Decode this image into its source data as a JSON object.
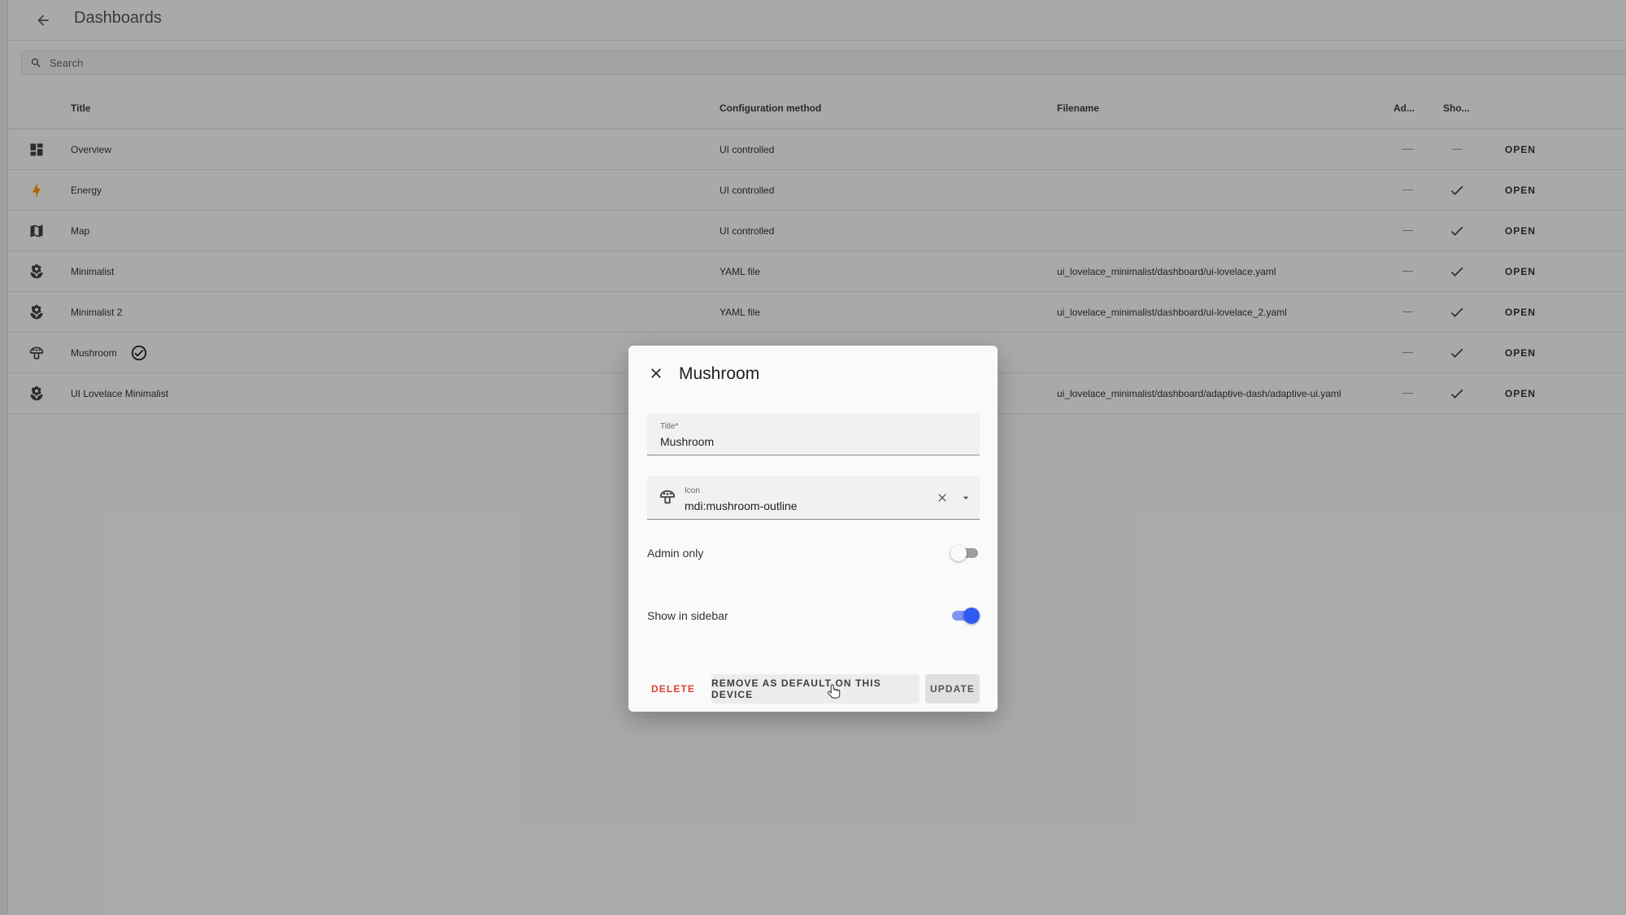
{
  "header": {
    "title": "Dashboards"
  },
  "search": {
    "placeholder": "Search"
  },
  "table": {
    "columns": {
      "title": "Title",
      "config_method": "Configuration method",
      "filename": "Filename",
      "admin": "Ad...",
      "show": "Sho..."
    },
    "rows": [
      {
        "icon": "view-dashboard-icon",
        "title": "Overview",
        "config": "UI controlled",
        "filename": "",
        "admin": "—",
        "show": "—",
        "action": "OPEN"
      },
      {
        "icon": "lightning-bolt-icon",
        "title": "Energy",
        "config": "UI controlled",
        "filename": "",
        "admin": "—",
        "show": "check",
        "action": "OPEN"
      },
      {
        "icon": "map-icon",
        "title": "Map",
        "config": "UI controlled",
        "filename": "",
        "admin": "—",
        "show": "check",
        "action": "OPEN"
      },
      {
        "icon": "flower-icon",
        "title": "Minimalist",
        "config": "YAML file",
        "filename": "ui_lovelace_minimalist/dashboard/ui-lovelace.yaml",
        "admin": "—",
        "show": "check",
        "action": "OPEN"
      },
      {
        "icon": "flower-icon",
        "title": "Minimalist 2",
        "config": "YAML file",
        "filename": "ui_lovelace_minimalist/dashboard/ui-lovelace_2.yaml",
        "admin": "—",
        "show": "check",
        "action": "OPEN"
      },
      {
        "icon": "mushroom-outline-icon",
        "title": "Mushroom",
        "config": "",
        "filename": "",
        "admin": "—",
        "show": "check",
        "action": "OPEN",
        "is_default": true
      },
      {
        "icon": "flower-icon",
        "title": "UI Lovelace Minimalist",
        "config": "",
        "filename": "ui_lovelace_minimalist/dashboard/adaptive-dash/adaptive-ui.yaml",
        "admin": "—",
        "show": "check",
        "action": "OPEN"
      }
    ]
  },
  "dialog": {
    "title": "Mushroom",
    "title_field": {
      "label": "Title*",
      "value": "Mushroom"
    },
    "icon_field": {
      "label": "Icon",
      "value": "mdi:mushroom-outline"
    },
    "admin_only": {
      "label": "Admin only",
      "checked": false
    },
    "show_in_sidebar": {
      "label": "Show in sidebar",
      "checked": true
    },
    "actions": {
      "delete": "DELETE",
      "remove_default": "REMOVE AS DEFAULT ON THIS DEVICE",
      "update": "UPDATE"
    }
  },
  "colors": {
    "accent": "#2f5bf2",
    "delete": "#db4437",
    "energy": "#ff9800"
  }
}
